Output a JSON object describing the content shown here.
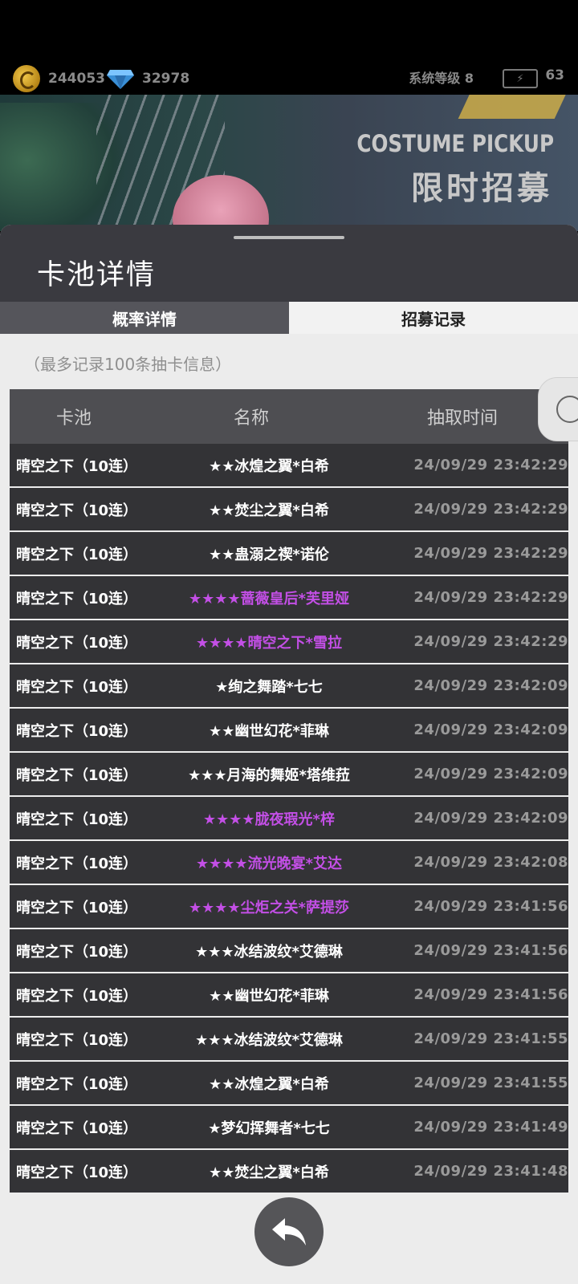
{
  "top_bar": {
    "gold": "244053",
    "diamonds": "32978",
    "system_level": "系统等级 8",
    "energy": "63"
  },
  "banner": {
    "title_en": "COSTUME PICKUP",
    "title_cn": "限时招募"
  },
  "panel": {
    "title": "卡池详情",
    "tabs": [
      {
        "label": "概率详情",
        "active": false
      },
      {
        "label": "招募记录",
        "active": true
      }
    ],
    "note": "（最多记录100条抽卡信息）"
  },
  "table": {
    "headers": [
      "卡池",
      "名称",
      "抽取时间"
    ],
    "rows": [
      {
        "pool": "晴空之下（10连）",
        "name": "★★冰煌之翼*白希",
        "rare": false,
        "time": "24/09/29 23:42:29"
      },
      {
        "pool": "晴空之下（10连）",
        "name": "★★焚尘之翼*白希",
        "rare": false,
        "time": "24/09/29 23:42:29"
      },
      {
        "pool": "晴空之下（10连）",
        "name": "★★蛊溺之禊*诺伦",
        "rare": false,
        "time": "24/09/29 23:42:29"
      },
      {
        "pool": "晴空之下（10连）",
        "name": "★★★★蔷薇皇后*芙里娅",
        "rare": true,
        "time": "24/09/29 23:42:29"
      },
      {
        "pool": "晴空之下（10连）",
        "name": "★★★★晴空之下*雪拉",
        "rare": true,
        "time": "24/09/29 23:42:29"
      },
      {
        "pool": "晴空之下（10连）",
        "name": "★绚之舞踏*七七",
        "rare": false,
        "time": "24/09/29 23:42:09"
      },
      {
        "pool": "晴空之下（10连）",
        "name": "★★幽世幻花*菲琳",
        "rare": false,
        "time": "24/09/29 23:42:09"
      },
      {
        "pool": "晴空之下（10连）",
        "name": "★★★月海的舞姬*塔维菈",
        "rare": false,
        "time": "24/09/29 23:42:09"
      },
      {
        "pool": "晴空之下（10连）",
        "name": "★★★★胧夜瑕光*梓",
        "rare": true,
        "time": "24/09/29 23:42:09"
      },
      {
        "pool": "晴空之下（10连）",
        "name": "★★★★流光晚宴*艾达",
        "rare": true,
        "time": "24/09/29 23:42:08"
      },
      {
        "pool": "晴空之下（10连）",
        "name": "★★★★尘炬之关*萨提莎",
        "rare": true,
        "time": "24/09/29 23:41:56"
      },
      {
        "pool": "晴空之下（10连）",
        "name": "★★★冰结波纹*艾德琳",
        "rare": false,
        "time": "24/09/29 23:41:56"
      },
      {
        "pool": "晴空之下（10连）",
        "name": "★★幽世幻花*菲琳",
        "rare": false,
        "time": "24/09/29 23:41:56"
      },
      {
        "pool": "晴空之下（10连）",
        "name": "★★★冰结波纹*艾德琳",
        "rare": false,
        "time": "24/09/29 23:41:55"
      },
      {
        "pool": "晴空之下（10连）",
        "name": "★★冰煌之翼*白希",
        "rare": false,
        "time": "24/09/29 23:41:55"
      },
      {
        "pool": "晴空之下（10连）",
        "name": "★梦幻挥舞者*七七",
        "rare": false,
        "time": "24/09/29 23:41:49"
      },
      {
        "pool": "晴空之下（10连）",
        "name": "★★焚尘之翼*白希",
        "rare": false,
        "time": "24/09/29 23:41:48"
      }
    ]
  },
  "colors": {
    "rare_name": "#c34fe6",
    "row_bg": "#333336",
    "header_bg": "#4e4e52",
    "panel_header_bg": "#3a3a40"
  },
  "icons": {
    "gold": "coin-icon",
    "diamond": "diamond-icon",
    "energy": "battery-icon",
    "back": "back-arrow-icon",
    "side": "headphones-icon"
  }
}
